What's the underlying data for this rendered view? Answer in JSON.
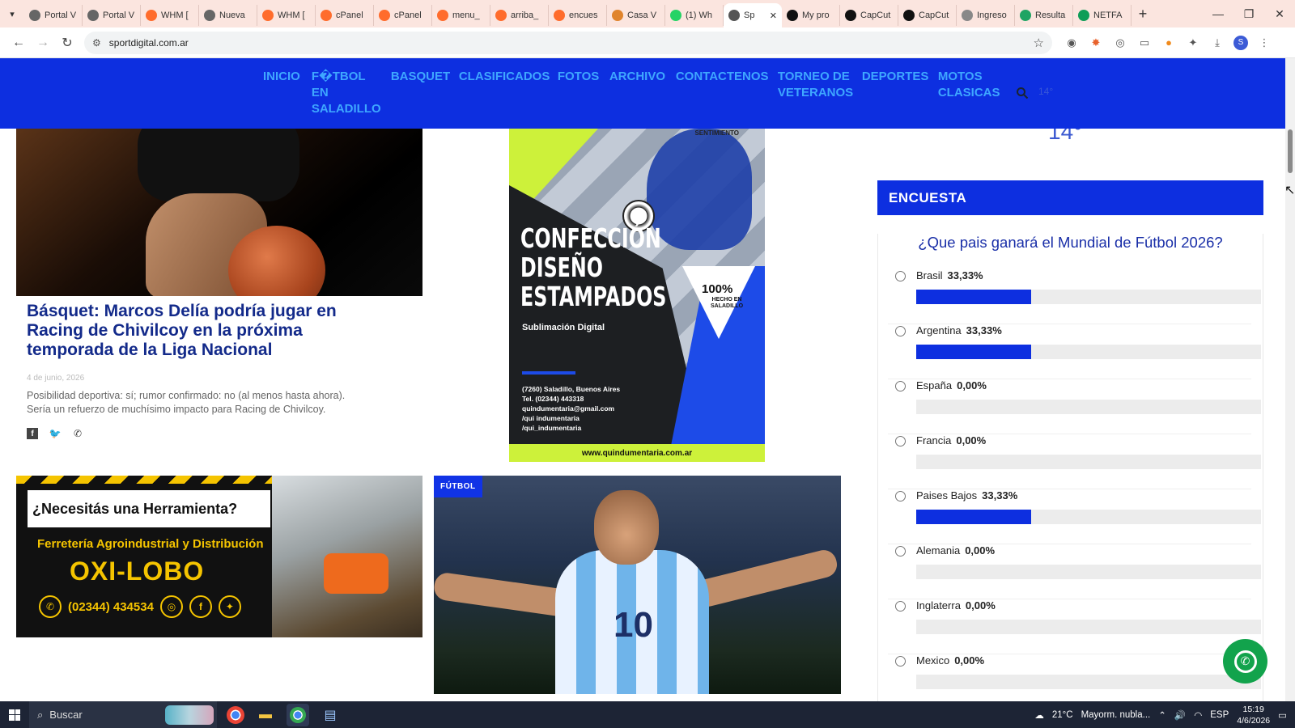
{
  "browser": {
    "tabs": [
      {
        "label": "Portal V",
        "icon": "globe-icon",
        "color": "#666"
      },
      {
        "label": "Portal V",
        "icon": "globe-icon",
        "color": "#666"
      },
      {
        "label": "WHM [",
        "icon": "cpanel-icon",
        "color": "#ff6c2c"
      },
      {
        "label": "Nueva",
        "icon": "globe-icon",
        "color": "#666"
      },
      {
        "label": "WHM [",
        "icon": "cpanel-icon",
        "color": "#ff6c2c"
      },
      {
        "label": "cPanel",
        "icon": "cpanel-icon",
        "color": "#ff6c2c"
      },
      {
        "label": "cPanel",
        "icon": "cpanel-icon",
        "color": "#ff6c2c"
      },
      {
        "label": "menu_",
        "icon": "cpanel-icon",
        "color": "#ff6c2c"
      },
      {
        "label": "arriba_",
        "icon": "cpanel-icon",
        "color": "#ff6c2c"
      },
      {
        "label": "encues",
        "icon": "cpanel-icon",
        "color": "#ff6c2c"
      },
      {
        "label": "Casa V",
        "icon": "question-icon",
        "color": "#e0842c"
      },
      {
        "label": "(1) Wh",
        "icon": "whatsapp-icon",
        "color": "#25d366"
      },
      {
        "label": "Sp",
        "icon": "globe-icon",
        "color": "#555",
        "active": true
      },
      {
        "label": "My pro",
        "icon": "capcut-icon",
        "color": "#111"
      },
      {
        "label": "CapCut",
        "icon": "capcut-icon",
        "color": "#111"
      },
      {
        "label": "CapCut",
        "icon": "capcut-icon",
        "color": "#111"
      },
      {
        "label": "Ingreso",
        "icon": "dot-icon",
        "color": "#888"
      },
      {
        "label": "Resulta",
        "icon": "drive-icon",
        "color": "#1fa463"
      },
      {
        "label": "NETFA",
        "icon": "sheet-icon",
        "color": "#0f9d58"
      }
    ],
    "url": "sportdigital.com.ar"
  },
  "site": {
    "nav": [
      "INICIO",
      "F�TBOL EN SALADILLO",
      "BASQUET",
      "CLASIFICADOS",
      "FOTOS",
      "ARCHIVO",
      "CONTACTENOS",
      "TORNEO DE VETERANOS",
      "DEPORTES",
      "MOTOS CLASICAS"
    ],
    "nav_temp": "14°",
    "temp_big": "14°"
  },
  "article": {
    "title": "Básquet: Marcos Delía podría jugar en Racing de Chivilcoy en la próxima temporada de la Liga Nacional",
    "date": "4 de junio, 2026",
    "excerpt": "Posibilidad deportiva: sí; rumor confirmado: no (al menos hasta ahora). Sería un refuerzo de muchísimo impacto para Racing de Chivilcoy."
  },
  "ad_quindumentaria": {
    "tag": "SENTIMIENTO",
    "headline": [
      "CONFECCIÓN",
      "DISEÑO",
      "ESTAMPADOS"
    ],
    "sub": "Sublimación Digital",
    "badge_pct": "100%",
    "badge_text": "HECHO EN SALADILLO",
    "contact": [
      "(7260) Saladillo, Buenos Aires",
      "Tel. (02344) 443318",
      "quindumentaria@gmail.com",
      "/qui indumentaria",
      "/qui_indumentaria"
    ],
    "web": "www.quindumentaria.com.ar"
  },
  "ad_oxilobo": {
    "question": "¿Necesitás una Herramienta?",
    "sub": "Ferretería Agroindustrial y Distribución",
    "brand": "OXI-LOBO",
    "phone": "(02344) 434534"
  },
  "feature": {
    "category": "FÚTBOL",
    "number": "10"
  },
  "poll": {
    "header": "ENCUESTA",
    "question": "¿Que pais ganará el Mundial de Fútbol 2026?",
    "options": [
      {
        "name": "Brasil",
        "pct": "33,33%",
        "value": 0.3333
      },
      {
        "name": "Argentina",
        "pct": "33,33%",
        "value": 0.3333
      },
      {
        "name": "España",
        "pct": "0,00%",
        "value": 0
      },
      {
        "name": "Francia",
        "pct": "0,00%",
        "value": 0
      },
      {
        "name": "Paises Bajos",
        "pct": "33,33%",
        "value": 0.3333
      },
      {
        "name": "Alemania",
        "pct": "0,00%",
        "value": 0
      },
      {
        "name": "Inglaterra",
        "pct": "0,00%",
        "value": 0
      },
      {
        "name": "Mexico",
        "pct": "0,00%",
        "value": 0
      }
    ]
  },
  "taskbar": {
    "search": "Buscar",
    "weather": "21°C",
    "weather_text": "Mayorm. nubla...",
    "lang": "ESP",
    "time": "15:19",
    "date": "4/6/2026"
  }
}
